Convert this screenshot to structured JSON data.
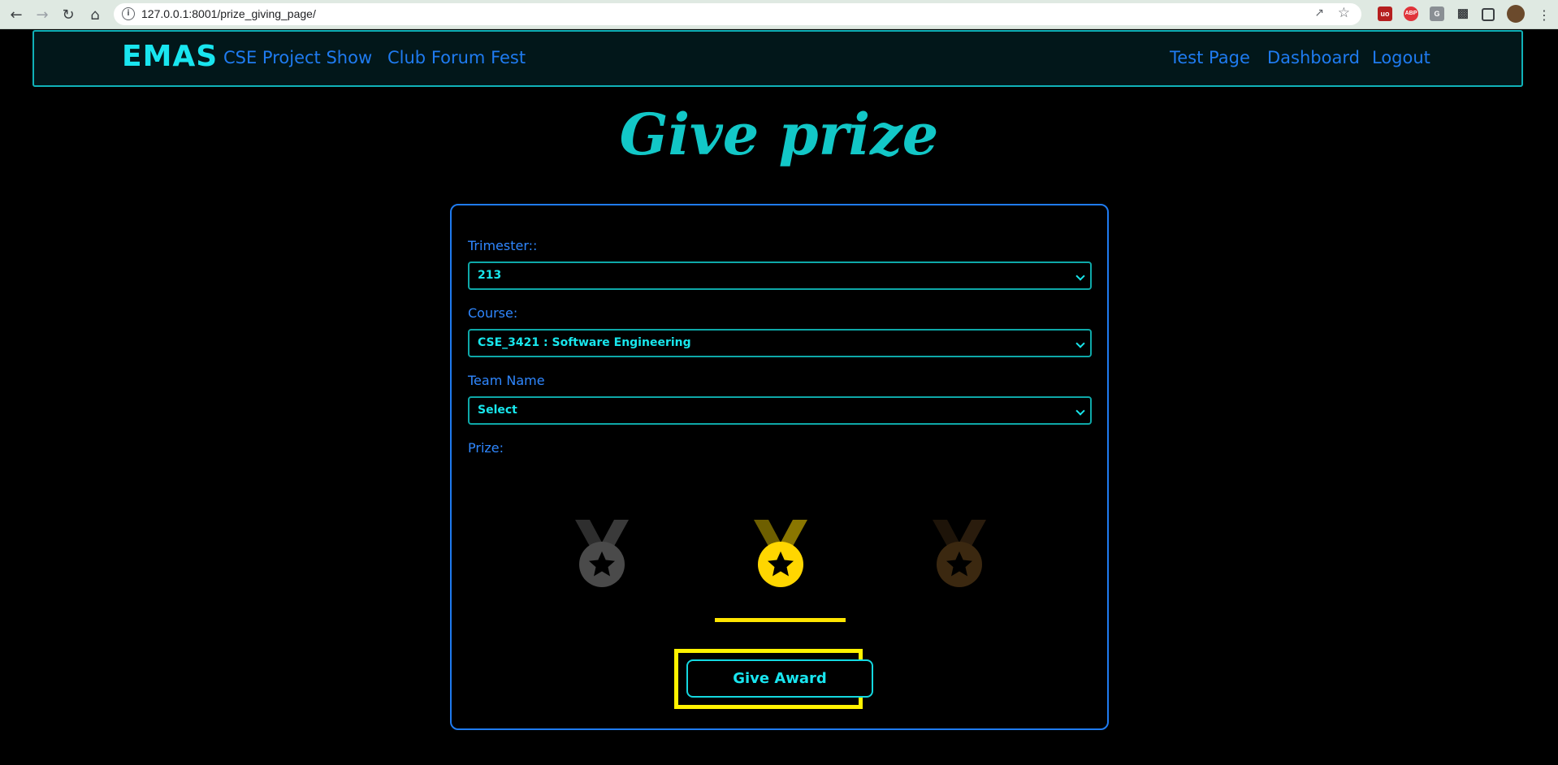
{
  "browser": {
    "url": "127.0.0.1:8001/prize_giving_page/",
    "extensions": [
      "uo-icon",
      "abp-icon",
      "g-icon",
      "puzzle-icon",
      "sidebar-icon",
      "avatar"
    ]
  },
  "navbar": {
    "brand": "EMAS",
    "left_links": [
      "CSE Project Show",
      "Club Forum Fest"
    ],
    "right_links": [
      "Test Page",
      "Dashboard",
      "Logout"
    ]
  },
  "page": {
    "title": "Give prize"
  },
  "form": {
    "trimester_label": "Trimester::",
    "trimester_value": "213",
    "course_label": "Course:",
    "course_value": "CSE_3421 : Software Engineering",
    "team_label": "Team Name",
    "team_value": "Select",
    "prize_label": "Prize:",
    "prizes": [
      {
        "name": "silver-medal",
        "selected": false
      },
      {
        "name": "gold-medal",
        "selected": true
      },
      {
        "name": "bronze-medal",
        "selected": false
      }
    ],
    "submit_label": "Give Award"
  },
  "colors": {
    "accent_cyan": "#19e5ef",
    "link_blue": "#1f7bf0",
    "gold": "#ffd600",
    "highlight_yellow": "#fff200"
  }
}
